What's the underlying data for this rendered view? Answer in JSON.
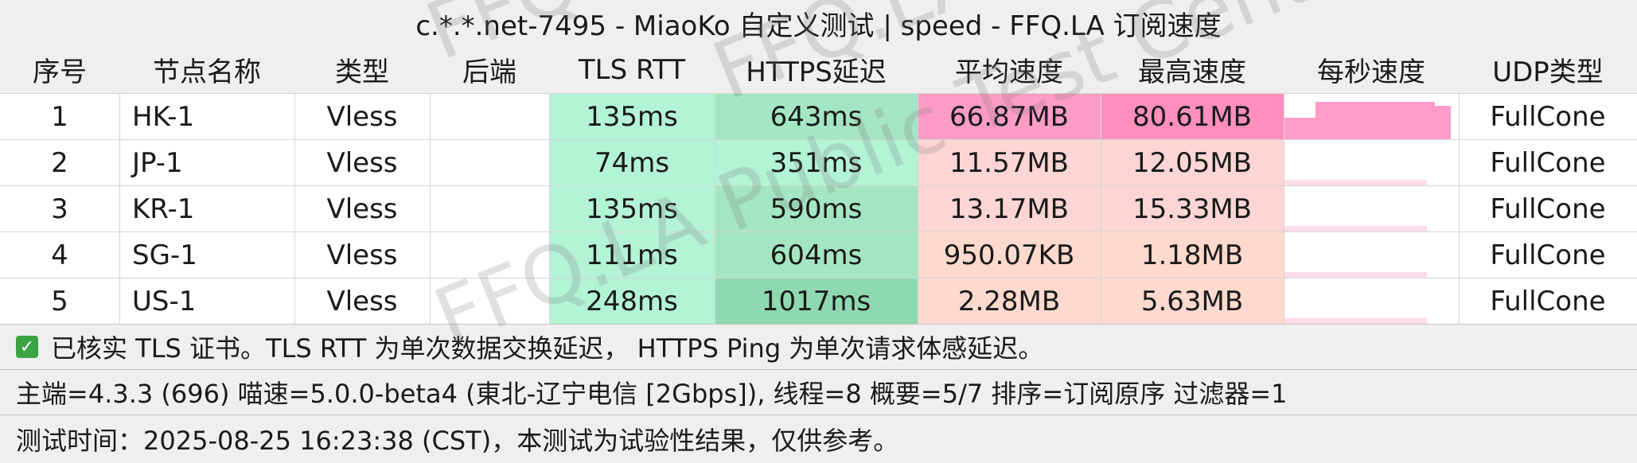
{
  "title": "c.*.*.net-7495 - MiaoKo 自定义测试 | speed - FFQ.LA 订阅速度",
  "columns": [
    "序号",
    "节点名称",
    "类型",
    "后端",
    "TLS RTT",
    "HTTPS延迟",
    "平均速度",
    "最高速度",
    "每秒速度",
    "UDP类型"
  ],
  "rows": [
    {
      "idx": "1",
      "name": "HK-1",
      "type": "Vless",
      "backend": "",
      "tls": "135ms",
      "https": "643ms",
      "avg": "66.87MB",
      "max": "80.61MB",
      "udp": "FullCone"
    },
    {
      "idx": "2",
      "name": "JP-1",
      "type": "Vless",
      "backend": "",
      "tls": "74ms",
      "https": "351ms",
      "avg": "11.57MB",
      "max": "12.05MB",
      "udp": "FullCone"
    },
    {
      "idx": "3",
      "name": "KR-1",
      "type": "Vless",
      "backend": "",
      "tls": "135ms",
      "https": "590ms",
      "avg": "13.17MB",
      "max": "15.33MB",
      "udp": "FullCone"
    },
    {
      "idx": "4",
      "name": "SG-1",
      "type": "Vless",
      "backend": "",
      "tls": "111ms",
      "https": "604ms",
      "avg": "950.07KB",
      "max": "1.18MB",
      "udp": "FullCone"
    },
    {
      "idx": "5",
      "name": "US-1",
      "type": "Vless",
      "backend": "",
      "tls": "248ms",
      "https": "1017ms",
      "avg": "2.28MB",
      "max": "5.63MB",
      "udp": "FullCone"
    }
  ],
  "colors": {
    "tls": [
      "#b3f3d6",
      "#b3f3d6",
      "#b3f3d6",
      "#b3f3d6",
      "#b3f3d6"
    ],
    "https": [
      "#a4e6c3",
      "#b3f3d6",
      "#a4e6c3",
      "#a4e6c3",
      "#8fd9b0"
    ],
    "avg": [
      "#ff9cc6",
      "#fcd5d5",
      "#fcd5d5",
      "#fdd9ce",
      "#fdd9ce"
    ],
    "max": [
      "#ff8fbd",
      "#fcd5d5",
      "#fcd5d5",
      "#fdd9ce",
      "#fdd9ce"
    ],
    "spark": "#ff9cc8"
  },
  "footer": {
    "check_icon": "checkbox-checked-icon",
    "line1": "已核实 TLS 证书。TLS RTT 为单次数据交换延迟， HTTPS Ping 为单次请求体感延迟。",
    "line2": "主端=4.3.3 (696) 喵速=5.0.0-beta4 (東北-辽宁电信 [2Gbps]), 线程=8 概要=5/7 排序=订阅原序 过滤器=1",
    "line3": "测试时间：2025-08-25 16:23:38 (CST)，本测试为试验性结果，仅供参考。"
  },
  "watermark": [
    "FFQ.LA Public Test Center",
    "FFQ.LA Public",
    "FFQ.LA Public Test Center"
  ]
}
